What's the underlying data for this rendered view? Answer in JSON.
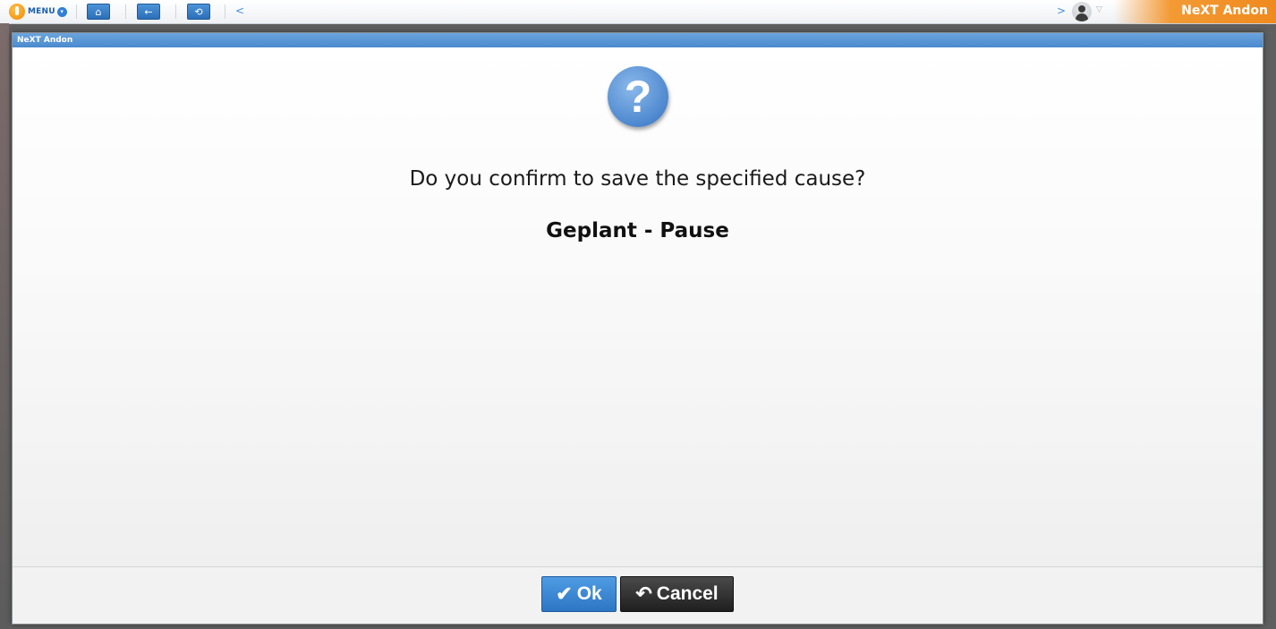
{
  "toolbar": {
    "menu_label": "Menu",
    "menu_chevron": "▾",
    "home_icon": "⌂",
    "back_icon": "←",
    "refresh_icon": "⟲",
    "prev_glyph": "<",
    "next_glyph": ">",
    "user_caret": "▽",
    "brand": "NeXT Andon"
  },
  "dialog": {
    "title": "NeXT Andon",
    "icon": "?",
    "message": "Do you confirm to save the specified cause?",
    "cause": "Geplant - Pause",
    "ok_icon": "✔",
    "ok_label": "Ok",
    "cancel_icon": "↶",
    "cancel_label": "Cancel"
  },
  "colors": {
    "accent": "#2d76c4",
    "brand": "#ef8a1e",
    "title_bar": "#4a8ace"
  }
}
